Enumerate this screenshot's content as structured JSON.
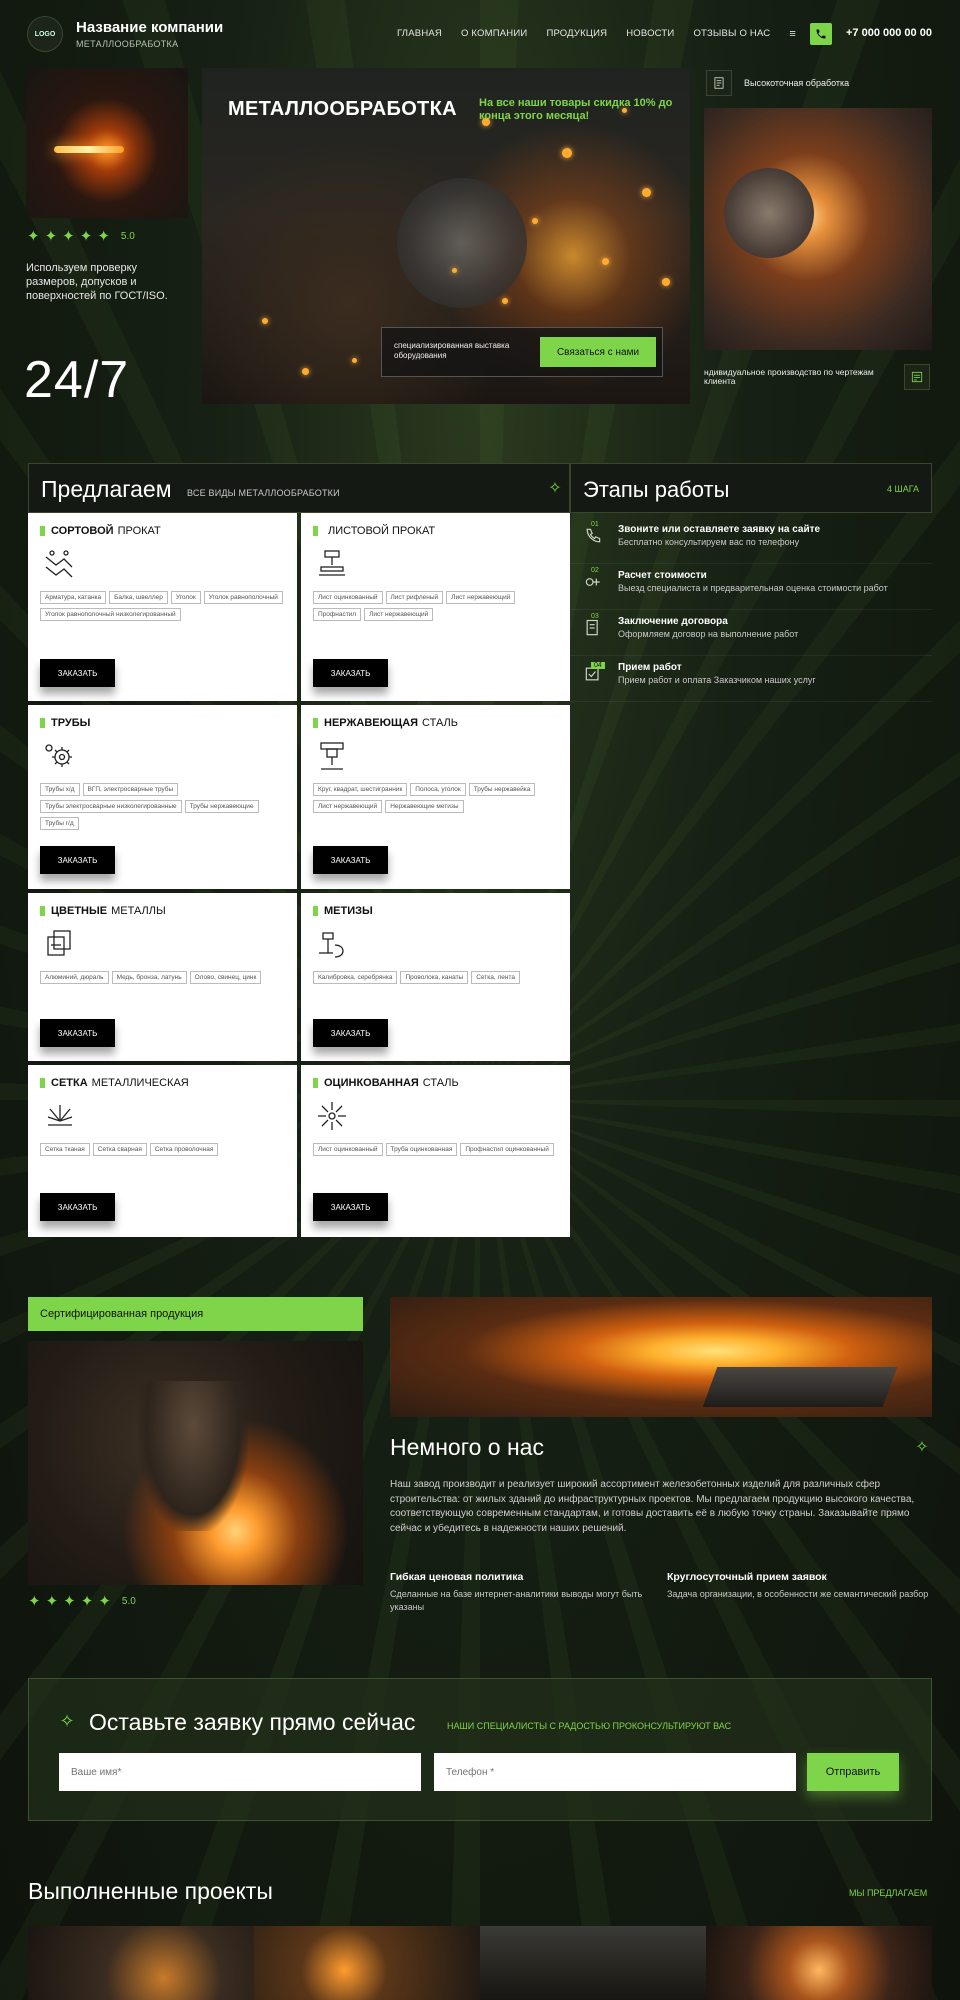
{
  "header": {
    "logo": "LOGO",
    "company_name": "Название компании",
    "company_sub": "МЕТАЛЛООБРАБОТКА",
    "nav": [
      "ГЛАВНАЯ",
      "О КОМПАНИИ",
      "ПРОДУКЦИЯ",
      "НОВОСТИ",
      "ОТЗЫВЫ О НАС"
    ],
    "nav_more": "≡",
    "phone": "+7 000 000 00 00"
  },
  "hero": {
    "rating": "5.0",
    "stars": 5,
    "left_text": "Используем проверку размеров, допусков и поверхностей по ГОСТ/ISO.",
    "big_text": "24/7",
    "title": "МЕТАЛЛООБРАБОТКА",
    "promo": "На все наши товары скидка 10% до конца этого месяца!",
    "cta_text": "специализированная выставка оборудования",
    "cta_button": "Связаться с нами",
    "right_label": "Высокоточная обработка",
    "right_text": "ндивидуальное производство по чертежам клиента"
  },
  "offer": {
    "title": "Предлагаем",
    "subtitle": "ВСЕ ВИДЫ МЕТАЛЛООБРАБОТКИ",
    "order_label": "ЗАКАЗАТЬ",
    "cards": [
      {
        "bold": "СОРТОВОЙ",
        "rest": "ПРОКАТ",
        "tags": [
          "Арматура, катанка",
          "Балка, швеллер",
          "Уголок",
          "Уголок равнополочный",
          "Уголок равнополочный низколегированный"
        ]
      },
      {
        "bold": "",
        "rest": "ЛИСТОВОЙ ПРОКАТ",
        "tags": [
          "Лист оцинкованный",
          "Лист рифленый",
          "Лист нержавеющий",
          "Профнастил",
          "Лист нержавеющий"
        ]
      },
      {
        "bold": "ТРУБЫ",
        "rest": "",
        "tags": [
          "Трубы х/д",
          "ВГП, электросварные трубы",
          "Трубы электросварные низколегированные",
          "Трубы нержавеющие",
          "Трубы г/д"
        ]
      },
      {
        "bold": "НЕРЖАВЕЮЩАЯ",
        "rest": "СТАЛЬ",
        "tags": [
          "Круг, квадрат, шестигранник",
          "Полоса, уголок",
          "Трубы нержавейка",
          "Лист нержавеющий",
          "Нержавеющие метизы"
        ]
      },
      {
        "bold": "ЦВЕТНЫЕ",
        "rest": "МЕТАЛЛЫ",
        "tags": [
          "Алюминий, дюраль",
          "Медь, бронза, латунь",
          "Олово, свинец, цинк"
        ]
      },
      {
        "bold": "МЕТИЗЫ",
        "rest": "",
        "tags": [
          "Калибровка, серебрянка",
          "Проволока, канаты",
          "Сетка, лента"
        ]
      },
      {
        "bold": "СЕТКА",
        "rest": "МЕТАЛЛИЧЕСКАЯ",
        "tags": [
          "Сетка тканая",
          "Сетка сварная",
          "Сетка проволочная"
        ]
      },
      {
        "bold": "ОЦИНКОВАННАЯ",
        "rest": "СТАЛЬ",
        "tags": [
          "Лист оцинкованный",
          "Труба оцинкованная",
          "Профнастил оцинкованный"
        ]
      }
    ]
  },
  "steps": {
    "title": "Этапы работы",
    "count": "4 ШАГА",
    "items": [
      {
        "num": "01",
        "title": "Звоните или оставляете заявку на сайте",
        "desc": "Бесплатно консультируем вас по телефону"
      },
      {
        "num": "02",
        "title": "Расчет стоимости",
        "desc": "Выезд специалиста и предварительная оценка стоимости работ"
      },
      {
        "num": "03",
        "title": "Заключение договора",
        "desc": "Оформляем договор на выполнение работ"
      },
      {
        "num": "04",
        "title": "Прием работ",
        "desc": "Прием работ и оплата Заказчиком наших услуг"
      }
    ]
  },
  "about": {
    "badge": "Сертифицированная продукция",
    "rating": "5.0",
    "title": "Немного о нас",
    "text": "Наш завод производит и реализует широкий ассортимент железобетонных изделий для различных сфер строительства: от жилых зданий до инфраструктурных проектов. Мы предлагаем продукцию высокого качества, соответствующую современным стандартам, и готовы доставить её в любую точку страны. Заказывайте прямо сейчас и убедитесь в надежности наших решений.",
    "features": [
      {
        "title": "Гибкая ценовая политика",
        "desc": "Сделанные на базе интернет-аналитики выводы могут быть указаны"
      },
      {
        "title": "Круглосуточный прием заявок",
        "desc": "Задача организации, в особенности же семантический разбор"
      }
    ]
  },
  "request": {
    "title": "Оставьте заявку прямо сейчас",
    "subtitle": "НАШИ СПЕЦИАЛИСТЫ С РАДОСТЬЮ ПРОКОНСУЛЬТИРУЮТ ВАС",
    "name_placeholder": "Ваше имя*",
    "phone_placeholder": "Телефон *",
    "submit": "Отправить"
  },
  "projects": {
    "title": "Выполненные проекты",
    "link": "МЫ ПРЕДЛАГАЕМ"
  },
  "colors": {
    "accent": "#7fd54a",
    "background": "#141b12",
    "card": "#ffffff",
    "button_dark": "#000000"
  }
}
